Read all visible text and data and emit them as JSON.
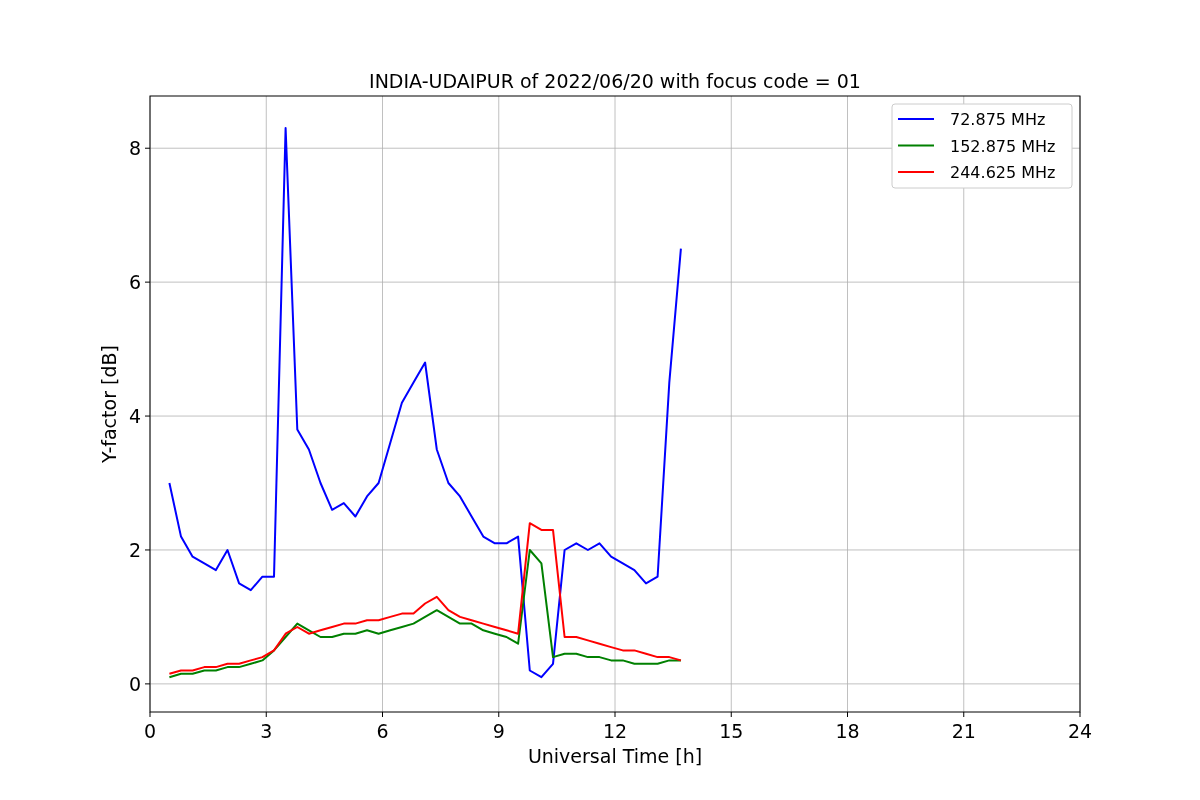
{
  "chart": {
    "chart_data": {
      "type": "line",
      "title": "INDIA-UDAIPUR of 2022/06/20 with focus code = 01",
      "xlabel": "Universal Time [h]",
      "ylabel": "Y-factor [dB]",
      "x": [
        0.5,
        0.8,
        1.1,
        1.4,
        1.7,
        2.0,
        2.3,
        2.6,
        2.9,
        3.2,
        3.5,
        3.8,
        4.1,
        4.4,
        4.7,
        5.0,
        5.3,
        5.6,
        5.9,
        6.2,
        6.5,
        6.8,
        7.1,
        7.4,
        7.7,
        8.0,
        8.3,
        8.6,
        8.9,
        9.2,
        9.5,
        9.8,
        10.1,
        10.4,
        10.7,
        11.0,
        11.3,
        11.6,
        11.9,
        12.2,
        12.5,
        12.8,
        13.1,
        13.4,
        13.7
      ],
      "series": [
        {
          "name": "72.875 MHz",
          "color": "#0000ff",
          "values": [
            3.0,
            2.2,
            1.9,
            1.8,
            1.7,
            2.0,
            1.5,
            1.4,
            1.6,
            1.6,
            8.3,
            3.8,
            3.5,
            3.0,
            2.6,
            2.7,
            2.5,
            2.8,
            3.0,
            3.6,
            4.2,
            4.5,
            4.8,
            3.5,
            3.0,
            2.8,
            2.5,
            2.2,
            2.1,
            2.1,
            2.2,
            0.2,
            0.1,
            0.3,
            2.0,
            2.1,
            2.0,
            2.1,
            1.9,
            1.8,
            1.7,
            1.5,
            1.6,
            4.5,
            6.5
          ]
        },
        {
          "name": "152.875 MHz",
          "color": "#008000",
          "values": [
            0.1,
            0.15,
            0.15,
            0.2,
            0.2,
            0.25,
            0.25,
            0.3,
            0.35,
            0.5,
            0.7,
            0.9,
            0.8,
            0.7,
            0.7,
            0.75,
            0.75,
            0.8,
            0.75,
            0.8,
            0.85,
            0.9,
            1.0,
            1.1,
            1.0,
            0.9,
            0.9,
            0.8,
            0.75,
            0.7,
            0.6,
            2.0,
            1.8,
            0.4,
            0.45,
            0.45,
            0.4,
            0.4,
            0.35,
            0.35,
            0.3,
            0.3,
            0.3,
            0.35,
            0.35
          ]
        },
        {
          "name": "244.625 MHz",
          "color": "#ff0000",
          "values": [
            0.15,
            0.2,
            0.2,
            0.25,
            0.25,
            0.3,
            0.3,
            0.35,
            0.4,
            0.5,
            0.75,
            0.85,
            0.75,
            0.8,
            0.85,
            0.9,
            0.9,
            0.95,
            0.95,
            1.0,
            1.05,
            1.05,
            1.2,
            1.3,
            1.1,
            1.0,
            0.95,
            0.9,
            0.85,
            0.8,
            0.75,
            2.4,
            2.3,
            2.3,
            0.7,
            0.7,
            0.65,
            0.6,
            0.55,
            0.5,
            0.5,
            0.45,
            0.4,
            0.4,
            0.35
          ]
        }
      ],
      "grid": true,
      "legend": true,
      "xlim": [
        0,
        24
      ],
      "ylim": [
        -0.42,
        8.78
      ],
      "xticks": [
        0,
        3,
        6,
        9,
        12,
        15,
        18,
        21,
        24
      ],
      "yticks": [
        0,
        2,
        4,
        6,
        8
      ]
    }
  }
}
